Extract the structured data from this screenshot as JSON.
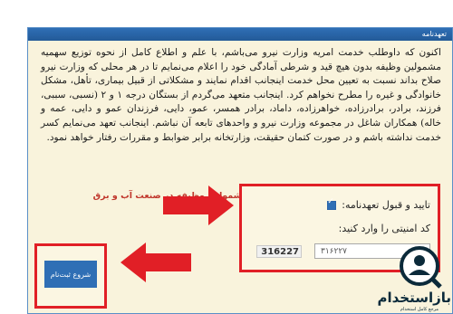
{
  "panel": {
    "header_title": "تعهدنامه",
    "paragraph": "اکنون که داوطلب خدمت امریه وزارت نیرو می‌باشم، با علم و اطلاع کامل از نحوه توزیع سهمیه مشمولین وظیفه بدون هیچ قید و شرطی آمادگی خود را اعلام می‌نمایم تا در هر محلی که وزارت نیرو صلاح بداند نسبت به تعیین محل خدمت اینجانب اقدام نمایند و مشکلاتی از قبیل بیماری، تأهل، مشکل خانوادگی و غیره را مطرح نخواهم کرد. اینجانب متعهد می‌گردم از بستگان درجه ۱ و ۲ (نسبی، سببی، فرزند، برادر، برادرزاده، خواهرزاده، داماد، برادر همسر، عمو، دایی، فرزندان عمو و دایی، عمه و خاله) همکاران شاغل در مجموعه وزارت نیرو و واحدهای تابعه آن نباشم. اینجانب تعهد می‌نمایم کسر خدمت نداشته باشم و در صورت کتمان حقیقت، وزارتخانه برابر ضوابط و مقررات رفتار خواهد نمود.",
    "regulation_link": "متن دستور العمل جذب و پذیرش مشمولین وظیفه در صنعت آب و برق"
  },
  "confirm": {
    "agree_label": "تایید و قبول تعهدنامه:",
    "agree_checked": true,
    "captcha_label": "کد امنیتی را وارد کنید:",
    "captcha_code": "316227",
    "captcha_value": "۳۱۶۲۲۷"
  },
  "start_button_label": "شروع ثبت‌نام",
  "watermark": {
    "brand": "بازاستخدام",
    "tagline": "مرجع کامل استخدام"
  },
  "colors": {
    "header_blue": "#2f6fb5",
    "highlight_red": "#e11f26",
    "link_red": "#c0362c"
  }
}
